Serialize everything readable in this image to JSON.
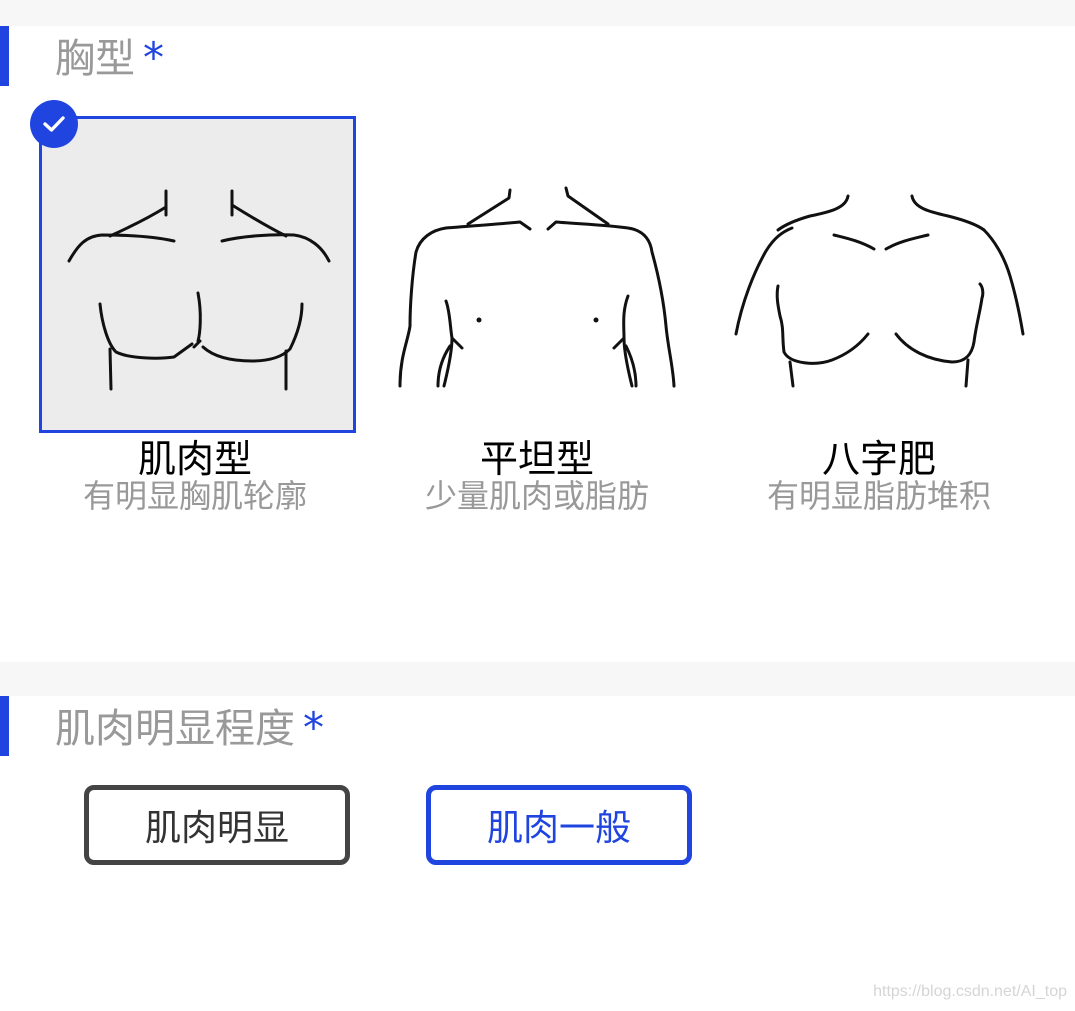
{
  "sections": {
    "chest_type": {
      "title": "胸型",
      "required_mark": "*"
    },
    "muscle_level": {
      "title": "肌肉明显程度",
      "required_mark": "*"
    }
  },
  "chest_options": [
    {
      "name": "肌肉型",
      "desc": "有明显胸肌轮廓",
      "selected": true
    },
    {
      "name": "平坦型",
      "desc": "少量肌肉或脂肪",
      "selected": false
    },
    {
      "name": "八字肥",
      "desc": "有明显脂肪堆积",
      "selected": false
    }
  ],
  "muscle_options": [
    {
      "label": "肌肉明显",
      "state": "default"
    },
    {
      "label": "肌肉一般",
      "state": "active"
    }
  ],
  "icons": {
    "selected_badge": "checkmark-icon"
  },
  "colors": {
    "accent": "#1f44e0",
    "muted_text": "#999999",
    "selected_bg": "#ececec"
  },
  "watermark": "https://blog.csdn.net/AI_top"
}
